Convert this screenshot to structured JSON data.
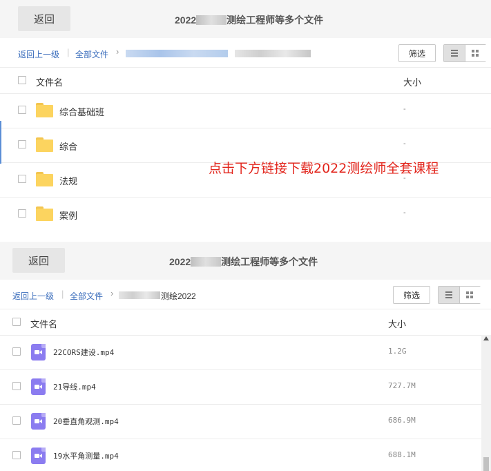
{
  "top": {
    "back_label": "返回",
    "title_prefix": "2022",
    "title_suffix": "测绘工程师等多个文件",
    "back_up_label": "返回上一级",
    "all_files_label": "全部文件",
    "filter_label": "筛选",
    "col_name": "文件名",
    "col_size": "大小",
    "rows": [
      {
        "name": "综合基础班",
        "size": "-",
        "icon": "folder-icon"
      },
      {
        "name": "综合",
        "size": "-",
        "icon": "folder-icon"
      },
      {
        "name": "法规",
        "size": "-",
        "icon": "folder-icon"
      },
      {
        "name": "案例",
        "size": "-",
        "icon": "folder-icon"
      }
    ]
  },
  "overlay_text": "点击下方链接下载2022测绘师全套课程",
  "bottom": {
    "back_label": "返回",
    "title_prefix": "2022",
    "title_suffix": "测绘工程师等多个文件",
    "back_up_label": "返回上一级",
    "all_files_label": "全部文件",
    "crumb_current": "测绘2022",
    "filter_label": "筛选",
    "col_name": "文件名",
    "col_size": "大小",
    "rows": [
      {
        "name": "22CORS建设.mp4",
        "size": "1.2G",
        "icon": "video-file-icon"
      },
      {
        "name": "21导线.mp4",
        "size": "727.7M",
        "icon": "video-file-icon"
      },
      {
        "name": "20垂直角观测.mp4",
        "size": "686.9M",
        "icon": "video-file-icon"
      },
      {
        "name": "19水平角测量.mp4",
        "size": "688.1M",
        "icon": "video-file-icon"
      }
    ]
  },
  "colors": {
    "link": "#3d6fbd",
    "overlay_red": "#e2251c",
    "folder_yellow": "#fcd45f",
    "video_purple": "#8b7cf0"
  }
}
